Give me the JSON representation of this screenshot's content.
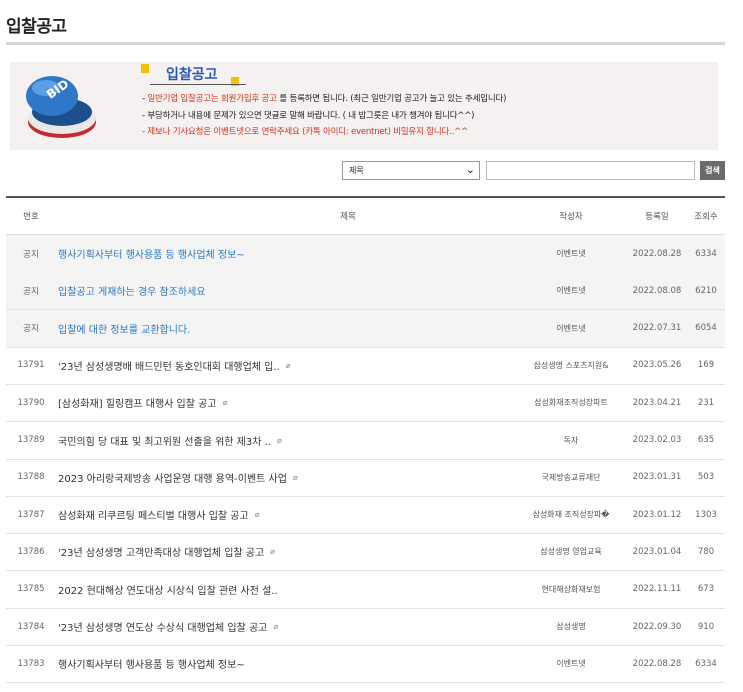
{
  "page_title": "입찰공고",
  "banner": {
    "heading": "입찰공고",
    "button_label": "BID",
    "line1_prefix": "- ",
    "line1_red": "일반기업 입찰공고는 회원가입후 공고",
    "line1_rest": "를 등록하면 됩니다. (최근 일반기업 공고가 늘고 있는 추세입니다)",
    "line2": "- 부당하거나 내용에 문제가 있으면 댓글로 말해 바랍니다. ( 내 밥그릇은 내가 챙겨야 됩니다^^)",
    "line3": "- 제보나 기사요청은 이벤트넷으로 연락주세요 (카톡 아이디: eventnet) 비밀유지 합니다..^^"
  },
  "search": {
    "select_value": "제목",
    "select_arrow": "⌄",
    "input_value": "",
    "button_label": "검색"
  },
  "table": {
    "headers": {
      "num": "번호",
      "title": "제목",
      "writer": "작성자",
      "date": "등록일",
      "views": "조회수"
    },
    "rows": [
      {
        "num": "공지",
        "title": "행사기획사부터 행사용품 등 행사업체 정보~",
        "writer": "이벤트넷",
        "date": "2022.08.28",
        "views": "6334",
        "notice": true,
        "attach": false
      },
      {
        "num": "공지",
        "title": "입찰공고 게재하는 경우 참조하세요",
        "writer": "이벤트넷",
        "date": "2022.08.08",
        "views": "6210",
        "notice": true,
        "attach": false
      },
      {
        "num": "공지",
        "title": "입찰에 대한 정보를 교환합니다.",
        "writer": "이벤트넷",
        "date": "2022.07.31",
        "views": "6054",
        "notice": true,
        "attach": false
      },
      {
        "num": "13791",
        "title": "'23년 삼성생명배 배드민턴 동호인대회 대행업체 입..",
        "writer": "삼성생명 스포츠지원&",
        "date": "2023.05.26",
        "views": "169",
        "notice": false,
        "attach": true
      },
      {
        "num": "13790",
        "title": "[삼성화재] 힐링캠프 대행사 입찰 공고",
        "writer": "삼성화재조직성장파트",
        "date": "2023.04.21",
        "views": "231",
        "notice": false,
        "attach": true
      },
      {
        "num": "13789",
        "title": "국민의힘 당 대표 및 최고위원 선출을 위한 제3차 ..",
        "writer": "독자",
        "date": "2023.02.03",
        "views": "635",
        "notice": false,
        "attach": true
      },
      {
        "num": "13788",
        "title": "2023 아리랑국제방송 사업운영 대행 용역-이벤트 사업",
        "writer": "국제방송교류재단",
        "date": "2023.01.31",
        "views": "503",
        "notice": false,
        "attach": true
      },
      {
        "num": "13787",
        "title": "삼성화재 리쿠르팅 페스티벌 대행사 입찰 공고",
        "writer": "삼성화재 조직성장파�",
        "date": "2023.01.12",
        "views": "1303",
        "notice": false,
        "attach": true
      },
      {
        "num": "13786",
        "title": "'23년 삼성생명 고객만족대상 대행업체 입찰 공고",
        "writer": "삼성생명 영업교육",
        "date": "2023.01.04",
        "views": "780",
        "notice": false,
        "attach": true
      },
      {
        "num": "13785",
        "title": "2022 현대해상 연도대상 시상식 입찰 관련 사전 설..",
        "writer": "현대해상화재보험",
        "date": "2022.11.11",
        "views": "673",
        "notice": false,
        "attach": false
      },
      {
        "num": "13784",
        "title": "'23년 삼성생명 연도상 수상식 대행업체 입찰 공고",
        "writer": "삼성생명",
        "date": "2022.09.30",
        "views": "910",
        "notice": false,
        "attach": true
      },
      {
        "num": "13783",
        "title": "행사기획사부터 행사용품 등 행사업체 정보~",
        "writer": "이벤트넷",
        "date": "2022.08.28",
        "views": "6334",
        "notice": false,
        "attach": false
      }
    ]
  },
  "attach_icon": "paperclip-icon",
  "attach_glyph": "⌀",
  "colors": {
    "notice_title": "#2a78c8",
    "banner_red": "#d6311f",
    "heading_blue": "#2a56b8"
  }
}
